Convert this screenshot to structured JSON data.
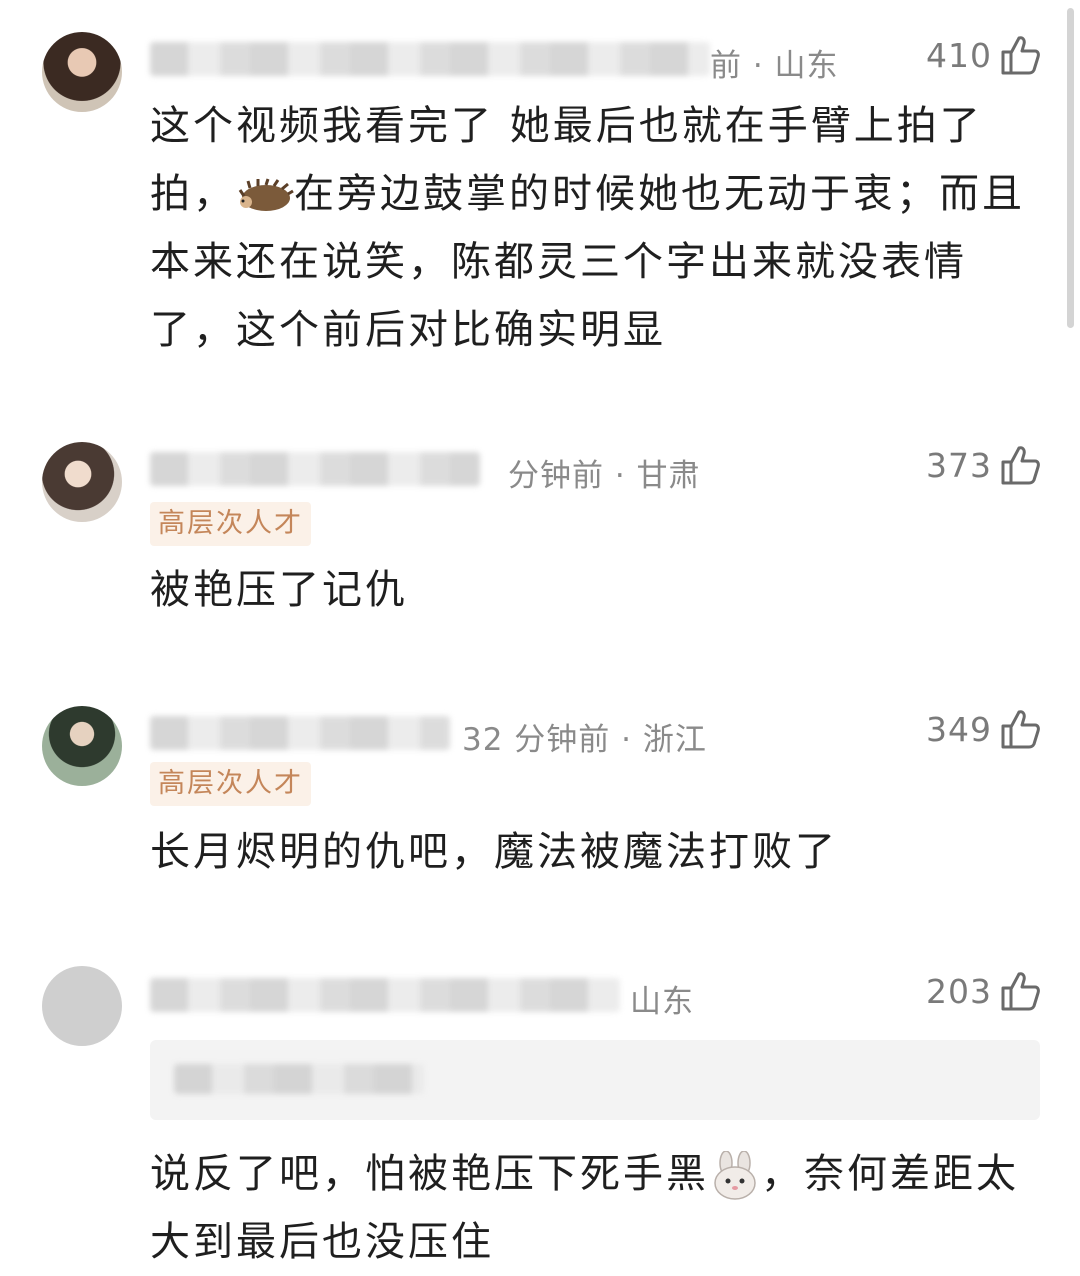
{
  "comments": [
    {
      "meta": "前 · 山东",
      "likes": "410",
      "badge": "",
      "text_before_emoji": "这个视频我看完了 她最后也就在手臂上拍了拍，",
      "emoji": "hedgehog-emoji",
      "text_after_emoji": "在旁边鼓掌的时候她也无动于衷；而且本来还在说笑，陈都灵三个字出来就没表情了，这个前后对比确实明显"
    },
    {
      "meta": "分钟前 · 甘肃",
      "likes": "373",
      "badge": "高层次人才",
      "text": "被艳压了记仇"
    },
    {
      "meta": "32 分钟前 · 浙江",
      "likes": "349",
      "badge": "高层次人才",
      "text": "长月烬明的仇吧，魔法被魔法打败了"
    },
    {
      "meta": "山东",
      "likes": "203",
      "badge": "",
      "text_before_emoji": "说反了吧，怕被艳压下死手黑",
      "emoji": "rabbit-emoji",
      "text_after_emoji": "，奈何差距太大到最后也没压住"
    }
  ],
  "colors": {
    "meta": "#8a8a8a",
    "badge_bg": "#fbf1e8",
    "badge_text": "#c4865a",
    "body_text": "#1f1f1f"
  }
}
